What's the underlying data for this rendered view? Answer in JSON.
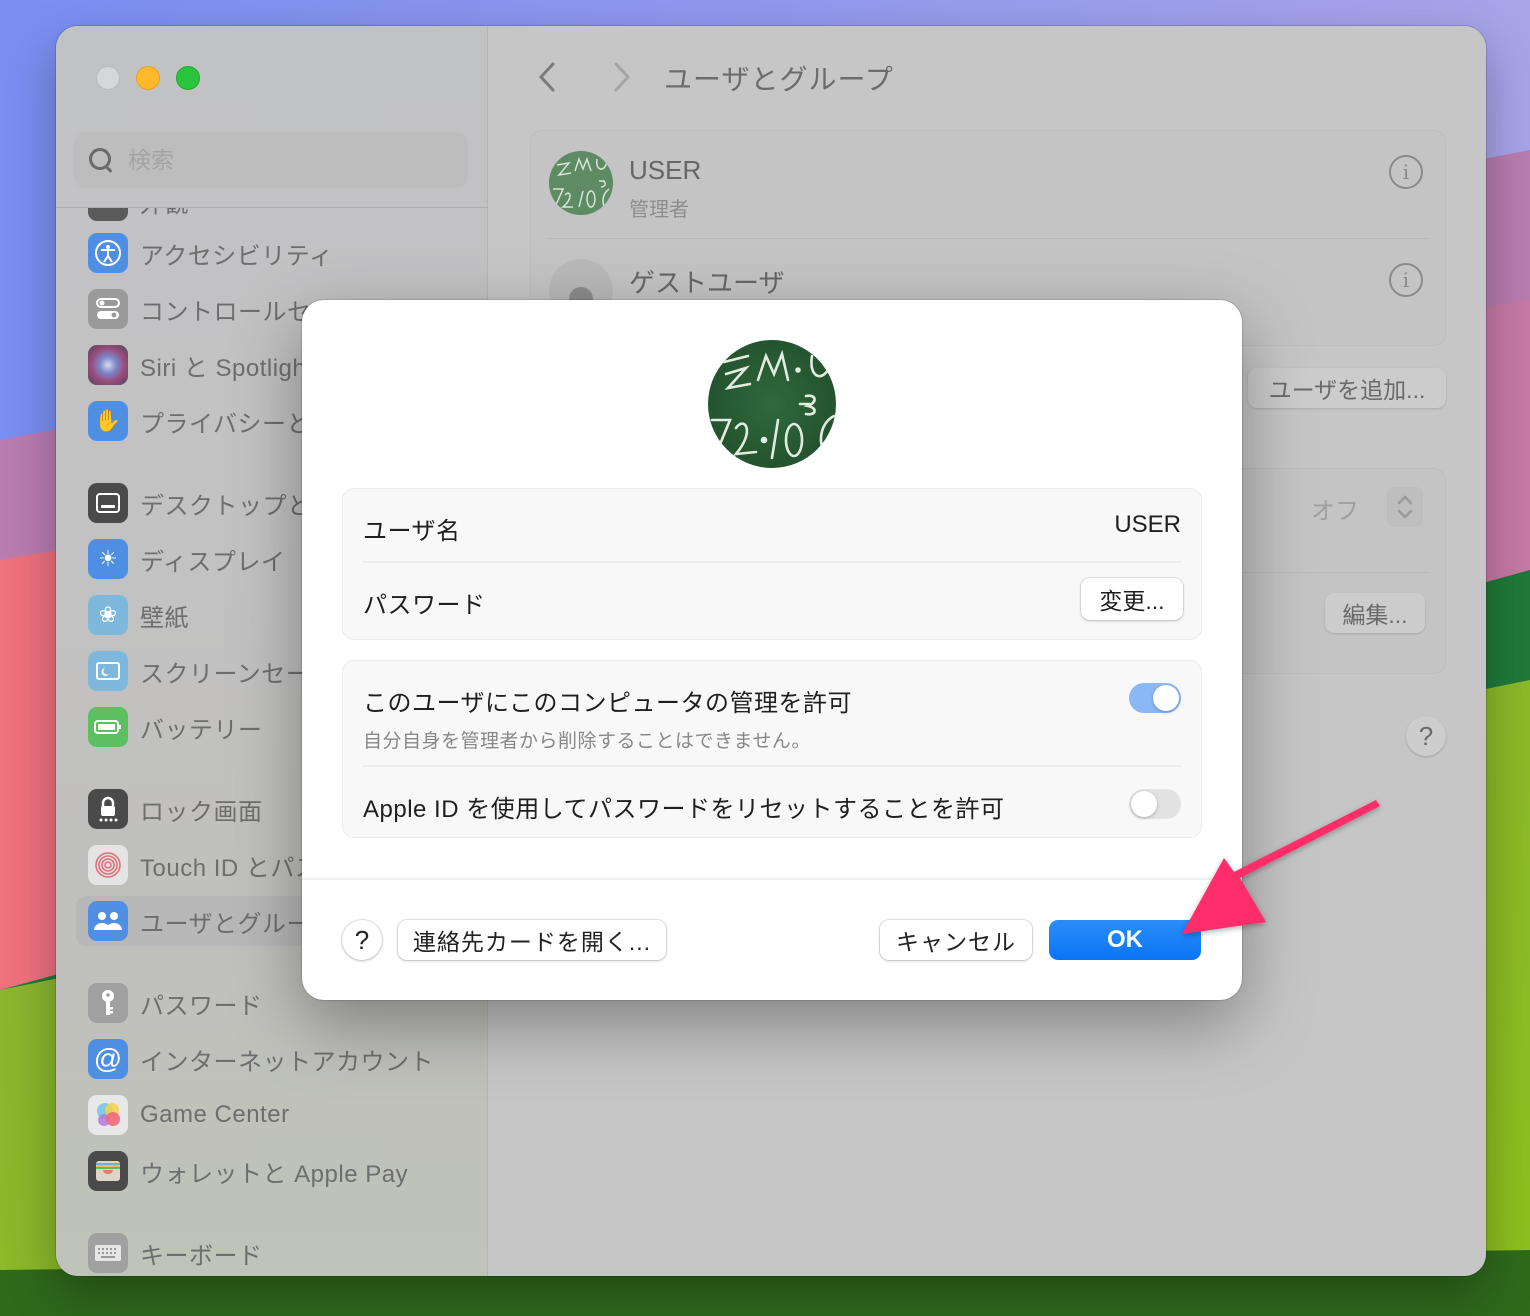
{
  "window": {
    "traffic_lights": [
      "close",
      "minimize",
      "maximize"
    ]
  },
  "sidebar": {
    "search_placeholder": "検索",
    "items": [
      {
        "label": "外観",
        "icon": "appearance-icon",
        "color": "#5a5a5a"
      },
      {
        "label": "アクセシビリティ",
        "icon": "accessibility-icon",
        "color": "#4f8fe3"
      },
      {
        "label": "コントロールセンター",
        "icon": "control-center-icon",
        "color": "#9a9a9a"
      },
      {
        "label": "Siri と Spotlight",
        "icon": "siri-icon",
        "color": "#8a5a8a"
      },
      {
        "label": "プライバシーとセキュリティ",
        "icon": "hand-icon",
        "color": "#4f8fe3"
      },
      {
        "label": "デスクトップとDock",
        "icon": "desktop-dock-icon",
        "color": "#4a4a4a"
      },
      {
        "label": "ディスプレイ",
        "icon": "display-brightness-icon",
        "color": "#4f8fe3"
      },
      {
        "label": "壁紙",
        "icon": "wallpaper-flower-icon",
        "color": "#7fb8dd"
      },
      {
        "label": "スクリーンセーバ",
        "icon": "screensaver-icon",
        "color": "#7fb8dd"
      },
      {
        "label": "バッテリー",
        "icon": "battery-icon",
        "color": "#5cc060"
      },
      {
        "label": "ロック画面",
        "icon": "lock-icon",
        "color": "#4a4a4a"
      },
      {
        "label": "Touch ID とパスワード",
        "icon": "fingerprint-icon",
        "color": "#e8e8e8"
      },
      {
        "label": "ユーザとグループ",
        "icon": "users-icon",
        "color": "#4f8fe3",
        "selected": true
      },
      {
        "label": "パスワード",
        "icon": "key-icon",
        "color": "#a0a0a0"
      },
      {
        "label": "インターネットアカウント",
        "icon": "at-icon",
        "color": "#4f8fe3"
      },
      {
        "label": "Game Center",
        "icon": "game-center-icon",
        "color": "#e8e8e8"
      },
      {
        "label": "ウォレットと Apple Pay",
        "icon": "wallet-icon",
        "color": "#4a4a4a"
      },
      {
        "label": "キーボード",
        "icon": "keyboard-icon",
        "color": "#a0a0a0"
      }
    ]
  },
  "main": {
    "title": "ユーザとグループ",
    "users": [
      {
        "name": "USER",
        "role": "管理者"
      },
      {
        "name": "ゲストユーザ",
        "role": ""
      }
    ],
    "add_user_label": "ユーザを追加...",
    "auto_login_value": "オフ",
    "edit_label": "編集...",
    "help_label": "?"
  },
  "sheet": {
    "username_label": "ユーザ名",
    "username_value": "USER",
    "password_label": "パスワード",
    "change_label": "変更...",
    "admin_label": "このユーザにこのコンピュータの管理を許可",
    "admin_sub": "自分自身を管理者から削除することはできません。",
    "admin_on": true,
    "appleid_label": "Apple ID を使用してパスワードをリセットすることを許可",
    "appleid_on": false,
    "help_label": "?",
    "contact_label": "連絡先カードを開く...",
    "cancel_label": "キャンセル",
    "ok_label": "OK"
  },
  "annotation": {
    "arrow_color": "#ff2d6a",
    "points_to": "ok-button"
  },
  "colors": {
    "accent": "#0a74f5",
    "toggle_on": "#8ab8f5"
  }
}
